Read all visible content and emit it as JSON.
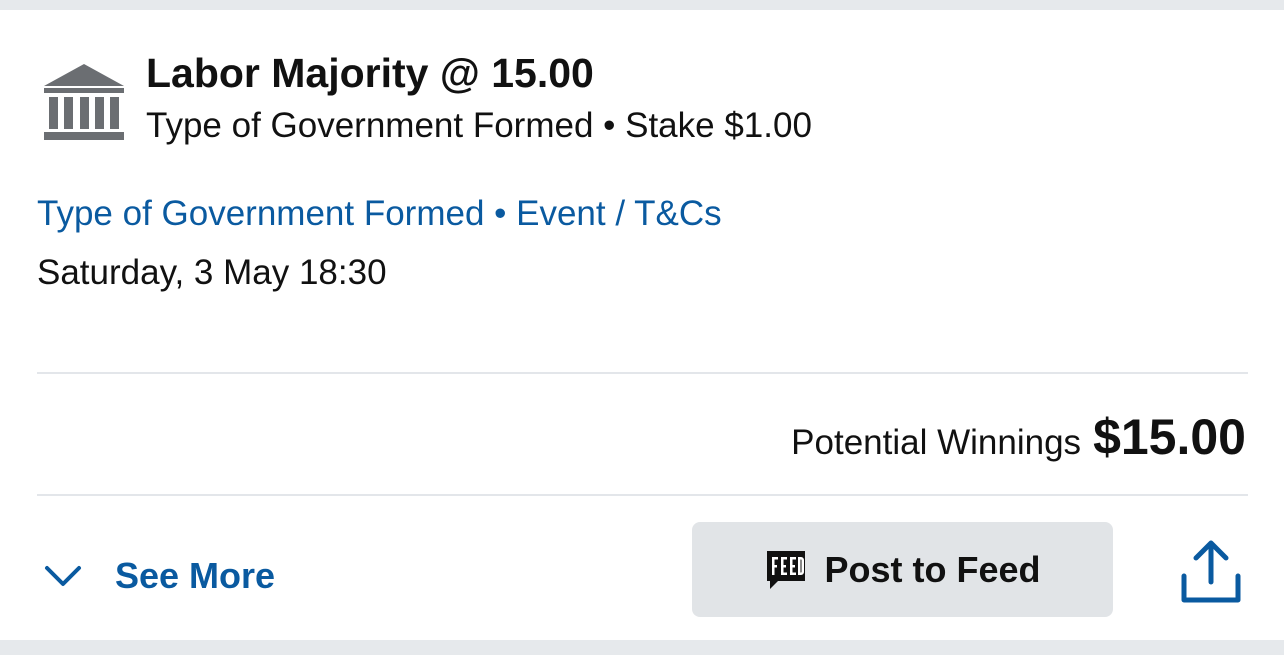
{
  "bet": {
    "title": "Labor Majority @ 15.00",
    "subtitle": "Type of Government Formed • Stake $1.00",
    "icon": "government-building-icon"
  },
  "links": {
    "market": "Type of Government Formed",
    "separator": " • ",
    "event": "Event / T&Cs"
  },
  "date": "Saturday, 3 May 18:30",
  "winnings": {
    "label": "Potential Winnings",
    "amount": "$15.00"
  },
  "actions": {
    "see_more": "See More",
    "post_to_feed": "Post to Feed",
    "share_icon": "share-upload-icon",
    "feed_icon": "feed-speech-bubble-icon",
    "chevron_icon": "chevron-down-icon"
  },
  "colors": {
    "link": "#0a5aa0",
    "text": "#111111",
    "icon_gray": "#6b6e72",
    "button_bg": "#e1e4e7",
    "page_bg": "#e6e9ec"
  }
}
